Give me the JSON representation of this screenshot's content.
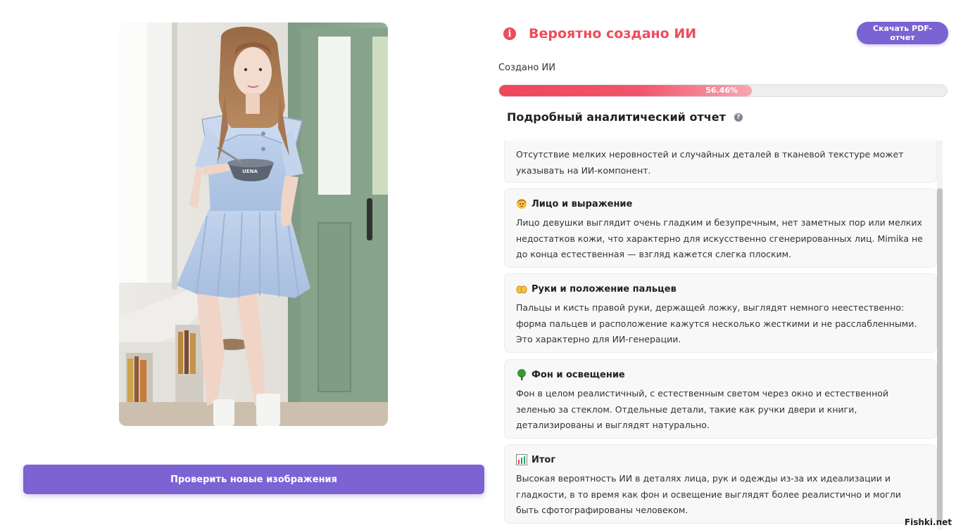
{
  "photo": {
    "caption": "UENA"
  },
  "check_button_label": "Проверить новые изображения",
  "verdict": {
    "title": "Вероятно создано ИИ",
    "icon": "info-icon",
    "color": "#ef4b5a"
  },
  "pdf_button_label": "Скачать PDF-отчет",
  "result": {
    "label": "Создано ИИ",
    "percent_text": "56.46%",
    "percent": 56.46
  },
  "report": {
    "title": "Подробный аналитический отчет",
    "help_icon": "question-icon",
    "partial_card_text": "Отсутствие мелких неровностей и случайных деталей в тканевой текстуре может указывать на ИИ-компонент.",
    "cards": [
      {
        "icon": "face-emoji-icon",
        "title": "Лицо и выражение",
        "body": "Лицо девушки выглядит очень гладким и безупречным, нет заметных пор или мелких недостатков кожи, что характерно для искусственно сгенерированных лиц. Mimika не до конца естественная — взгляд кажется слегка плоским."
      },
      {
        "icon": "hands-emoji-icon",
        "title": "Руки и положение пальцев",
        "body": "Пальцы и кисть правой руки, держащей ложку, выглядят немного неестественно: форма пальцев и расположение кажутся несколько жесткими и не расслабленными. Это характерно для ИИ-генерации."
      },
      {
        "icon": "tree-emoji-icon",
        "title": "Фон и освещение",
        "body": "Фон в целом реалистичный, с естественным светом через окно и естественной зеленью за стеклом. Отдельные детали, такие как ручки двери и книги, детализированы и выглядят натурально."
      },
      {
        "icon": "chart-emoji-icon",
        "title": "Итог",
        "body": "Высокая вероятность ИИ в деталях лица, рук и одежды из-за их идеализации и гладкости, в то время как фон и освещение выглядят более реалистично и могли быть сфотографированы человеком."
      }
    ]
  },
  "watermark": "Fishki.net",
  "colors": {
    "accent": "#7b63d3",
    "danger": "#ef4b5a"
  }
}
